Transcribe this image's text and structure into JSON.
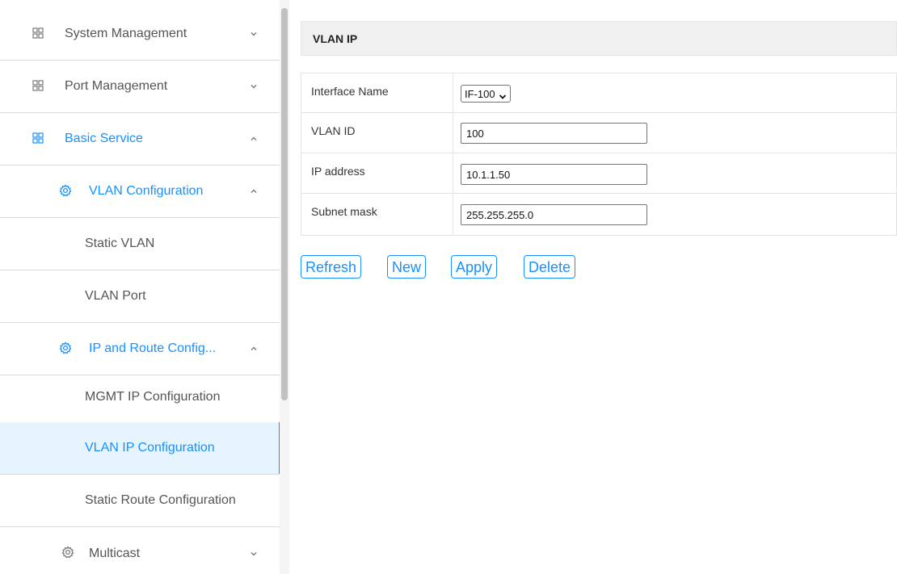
{
  "sidebar": {
    "items": [
      {
        "label": "System Management",
        "icon": "grid-icon"
      },
      {
        "label": "Port Management",
        "icon": "grid-icon"
      },
      {
        "label": "Basic Service",
        "icon": "grid-icon"
      },
      {
        "label": "VLAN Configuration",
        "icon": "gear-icon"
      },
      {
        "label": "Static VLAN"
      },
      {
        "label": "VLAN Port"
      },
      {
        "label": "IP and Route Config...",
        "icon": "gear-icon"
      },
      {
        "label": "MGMT IP Configuration"
      },
      {
        "label": "VLAN IP Configuration"
      },
      {
        "label": "Static Route Configuration"
      },
      {
        "label": "Multicast",
        "icon": "gear-icon"
      }
    ]
  },
  "panel": {
    "title": "VLAN IP"
  },
  "form": {
    "interface_name": {
      "label": "Interface Name",
      "value": "IF-100"
    },
    "vlan_id": {
      "label": "VLAN ID",
      "value": "100"
    },
    "ip_address": {
      "label": "IP address",
      "value": "10.1.1.50"
    },
    "subnet_mask": {
      "label": "Subnet mask",
      "value": "255.255.255.0"
    }
  },
  "buttons": {
    "refresh": "Refresh",
    "new": "New",
    "apply": "Apply",
    "delete": "Delete"
  },
  "colors": {
    "accent": "#1890ff",
    "selected_bg": "#e6f4fd"
  }
}
